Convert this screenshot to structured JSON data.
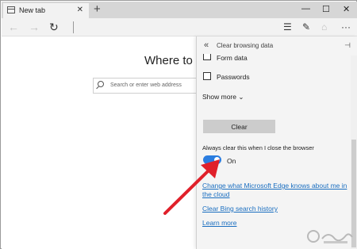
{
  "browser": {
    "tab_title": "New tab",
    "tab_close": "✕",
    "new_tab": "+",
    "window_controls": {
      "minimize": "—",
      "maximize": "☐",
      "close": "✕"
    },
    "nav_icons": [
      "back-icon",
      "forward-icon",
      "refresh-icon",
      "hub-icon",
      "web-note-icon",
      "share-icon",
      "more-icon"
    ]
  },
  "page": {
    "headline": "Where to n",
    "search_placeholder": "Search or enter web address"
  },
  "panel": {
    "back": "«",
    "title": "Clear browsing data",
    "pin": "⊣",
    "checkboxes": [
      {
        "label": "Form data",
        "checked": false
      },
      {
        "label": "Passwords",
        "checked": false
      }
    ],
    "show_more": "Show more",
    "clear_button": "Clear",
    "always_clear_label": "Always clear this when I close the browser",
    "toggle_state": "On",
    "toggle_on": true,
    "links": {
      "change_line1": "Change what Microsoft Edge knows about me in",
      "change_line2": "the cloud",
      "bing_history": "Clear Bing search history",
      "learn_more": "Learn more"
    }
  },
  "colors": {
    "accent": "#2b7de0",
    "link": "#1a6ec0",
    "annotation_arrow": "#e0202a"
  }
}
